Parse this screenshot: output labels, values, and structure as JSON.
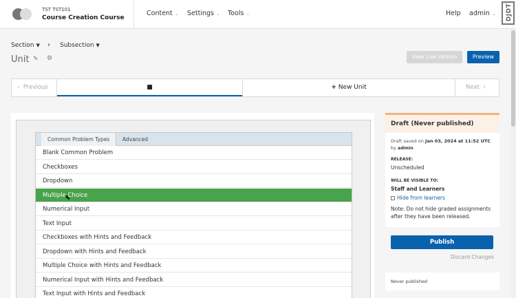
{
  "header": {
    "course_org": "TST TST101",
    "course_name": "Course Creation Course",
    "nav": [
      "Content",
      "Settings",
      "Tools"
    ],
    "help": "Help",
    "user": "admin",
    "djdt": "DJDT"
  },
  "breadcrumb": {
    "section": "Section",
    "subsection": "Subsection",
    "separator": "›"
  },
  "unit": {
    "title": "Unit",
    "view_live": "View Live Version",
    "preview": "Preview"
  },
  "unit_nav": {
    "previous": "Previous",
    "new_unit": "New Unit",
    "next": "Next"
  },
  "picker": {
    "tabs": [
      "Common Problem Types",
      "Advanced"
    ],
    "items": [
      "Blank Common Problem",
      "Checkboxes",
      "Dropdown",
      "Multiple Choice",
      "Numerical Input",
      "Text Input",
      "Checkboxes with Hints and Feedback",
      "Dropdown with Hints and Feedback",
      "Multiple Choice with Hints and Feedback",
      "Numerical Input with Hints and Feedback",
      "Text Input with Hints and Feedback"
    ],
    "selected": "Multiple Choice"
  },
  "sidebar": {
    "title": "Draft (Never published)",
    "draft_prefix": "Draft saved on ",
    "draft_date": "Jan 03, 2024 at 11:52 UTC",
    "draft_by": " by ",
    "draft_user": "admin",
    "release_label": "RELEASE:",
    "release_value": "Unscheduled",
    "visible_label": "WILL BE VISIBLE TO:",
    "visible_value": "Staff and Learners",
    "hide_link": "Hide from learners",
    "note": "Note: Do not hide graded assignments after they have been released.",
    "publish": "Publish",
    "discard": "Discard Changes",
    "never": "Never published"
  },
  "colors": {
    "primary": "#0a62ad",
    "selected_row": "#49a24c",
    "draft_border": "#f0b37e"
  }
}
